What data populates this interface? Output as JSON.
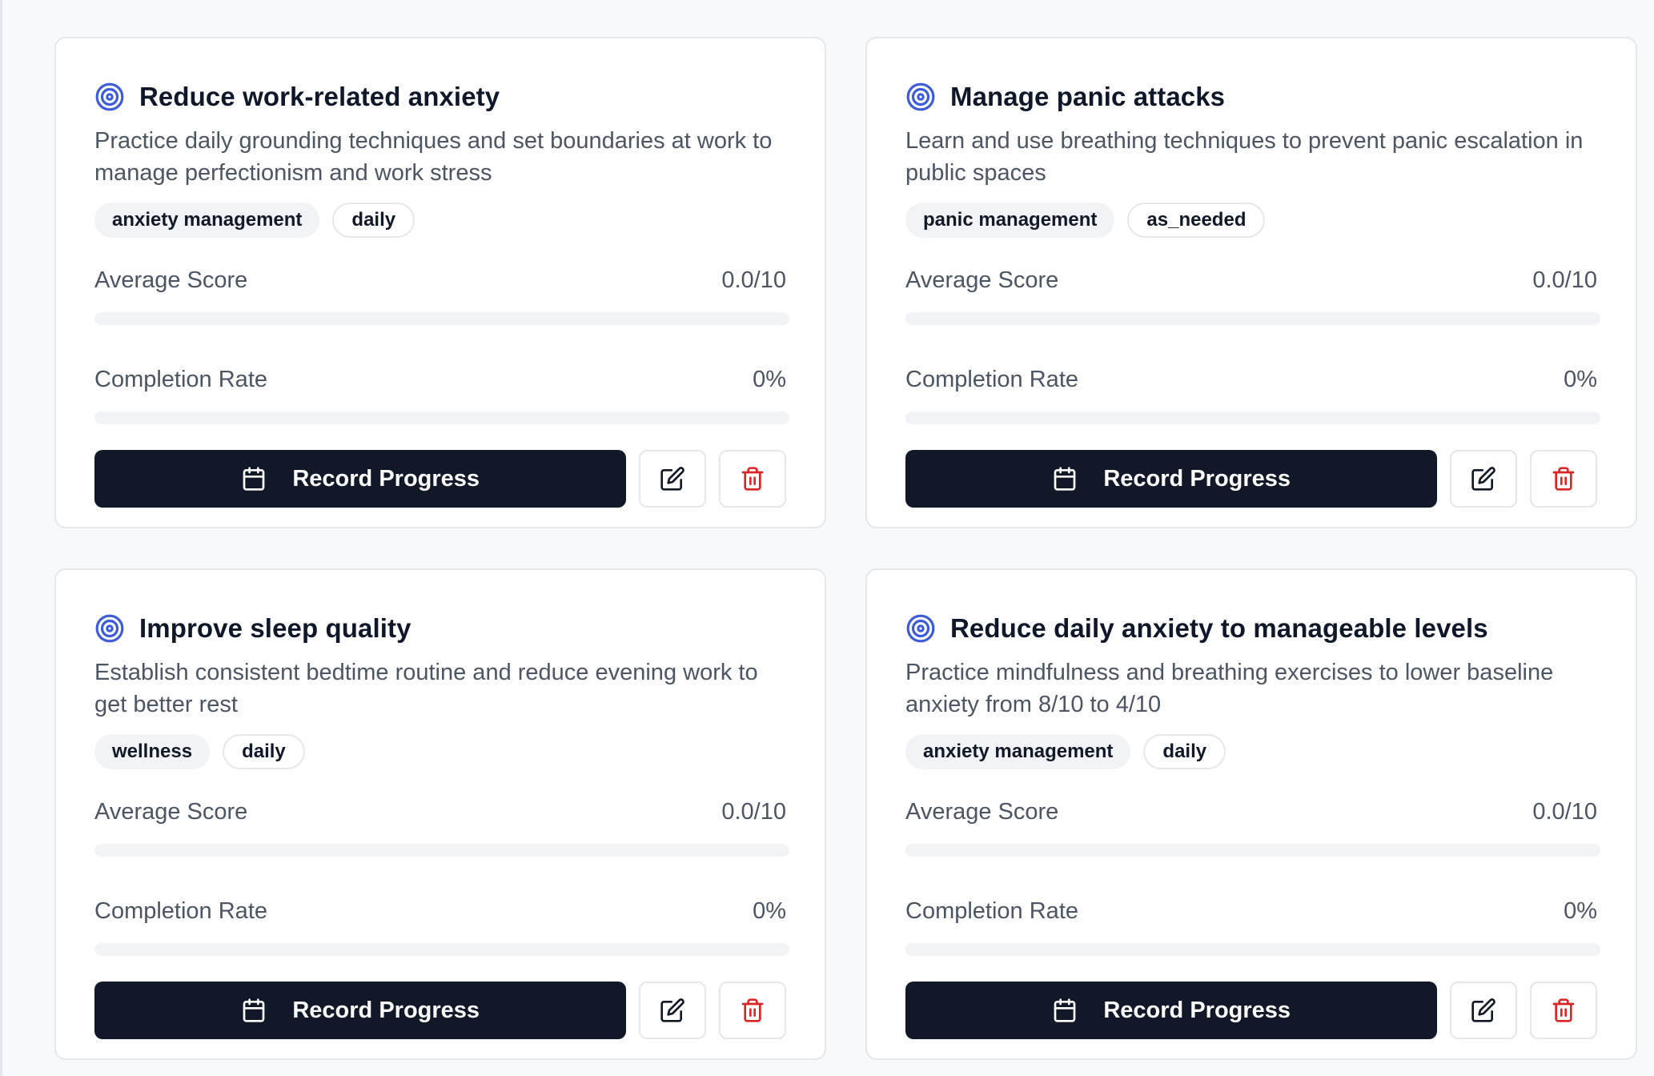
{
  "colors": {
    "accent_blue": "#3b5bdb",
    "primary_dark": "#111827",
    "delete_red": "#dc2626",
    "muted_text": "#4b5563"
  },
  "labels": {
    "average_score": "Average Score",
    "completion_rate": "Completion Rate",
    "record_progress": "Record Progress"
  },
  "goals": [
    {
      "title": "Reduce work-related anxiety",
      "description": "Practice daily grounding techniques and set boundaries at work to manage perfectionism and work stress",
      "category": "anxiety management",
      "frequency": "daily",
      "average_score": "0.0/10",
      "average_score_fraction": 0,
      "completion_rate": "0%",
      "completion_fraction": 0
    },
    {
      "title": "Manage panic attacks",
      "description": "Learn and use breathing techniques to prevent panic escalation in public spaces",
      "category": "panic management",
      "frequency": "as_needed",
      "average_score": "0.0/10",
      "average_score_fraction": 0,
      "completion_rate": "0%",
      "completion_fraction": 0
    },
    {
      "title": "Improve sleep quality",
      "description": "Establish consistent bedtime routine and reduce evening work to get better rest",
      "category": "wellness",
      "frequency": "daily",
      "average_score": "0.0/10",
      "average_score_fraction": 0,
      "completion_rate": "0%",
      "completion_fraction": 0
    },
    {
      "title": "Reduce daily anxiety to manageable levels",
      "description": "Practice mindfulness and breathing exercises to lower baseline anxiety from 8/10 to 4/10",
      "category": "anxiety management",
      "frequency": "daily",
      "average_score": "0.0/10",
      "average_score_fraction": 0,
      "completion_rate": "0%",
      "completion_fraction": 0
    }
  ],
  "icons": {
    "goal": "target-icon",
    "record": "calendar-icon",
    "edit": "edit-icon",
    "delete": "trash-icon"
  }
}
